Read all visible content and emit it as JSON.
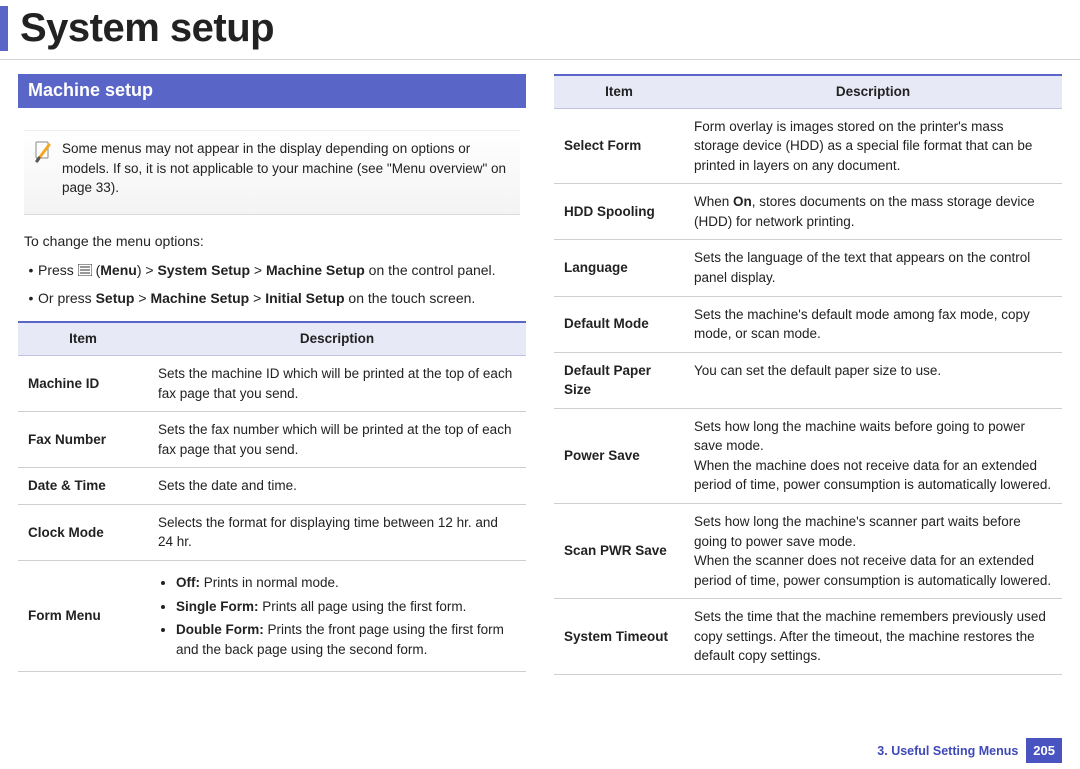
{
  "title": "System setup",
  "section_heading": "Machine setup",
  "note": "Some menus may not appear in the display depending on options or models. If so, it is not applicable to your machine (see \"Menu overview\" on page 33).",
  "intro": "To change the menu options:",
  "steps": {
    "s1_pre": "Press ",
    "s1_b1": "Menu",
    "s1_mid1": ") > ",
    "s1_b2": "System Setup",
    "s1_mid2": " > ",
    "s1_b3": "Machine Setup",
    "s1_post": " on the control panel.",
    "s2_pre": "Or press ",
    "s2_b1": "Setup",
    "s2_mid1": " > ",
    "s2_b2": "Machine Setup",
    "s2_mid2": " > ",
    "s2_b3": "Initial Setup",
    "s2_post": " on the touch screen."
  },
  "th_item": "Item",
  "th_desc": "Description",
  "tableA": {
    "r0": {
      "item": "Machine ID",
      "desc": "Sets the machine ID which will be printed at the top of each fax page that you send."
    },
    "r1": {
      "item": "Fax Number",
      "desc": "Sets the fax number which will be printed at the top of each fax page that you send."
    },
    "r2": {
      "item": "Date & Time",
      "desc": "Sets the date and time."
    },
    "r3": {
      "item": "Clock Mode",
      "desc": "Selects the format for displaying time between 12 hr. and 24 hr."
    },
    "r4": {
      "item": "Form Menu"
    },
    "form_menu": {
      "b0_label": "Off:",
      "b0_rest": " Prints in normal mode.",
      "b1_label": "Single Form:",
      "b1_rest": " Prints all page using the first form.",
      "b2_label": "Double Form:",
      "b2_rest": " Prints the front page using the first form and the back page using the second form."
    }
  },
  "tableB": {
    "r0": {
      "item": "Select Form"
    },
    "select_form": "Form overlay is images stored on the printer's mass storage device (HDD) as a special file format that can be printed in layers on any document.",
    "r1": {
      "item": "HDD Spooling"
    },
    "hdd_pre": "When ",
    "hdd_bold": "On",
    "hdd_post": ", stores documents on the mass storage device (HDD) for network printing.",
    "r2": {
      "item": "Language",
      "desc": "Sets the language of the text that appears on the control panel display."
    },
    "r3": {
      "item": "Default Mode",
      "desc": "Sets the machine's default mode among fax mode, copy mode, or scan mode."
    },
    "r4": {
      "item": "Default Paper Size",
      "desc": "You can set the default paper size to use."
    },
    "r5": {
      "item": "Power Save"
    },
    "power_p1": "Sets how long the machine waits before going to power save mode.",
    "power_p2": "When the machine does not receive data for an extended period of time, power consumption is automatically lowered.",
    "r6": {
      "item": "Scan PWR Save"
    },
    "scan_p1": "Sets how long the machine's scanner part waits before going to power save mode.",
    "scan_p2": "When the scanner does not receive data for an extended period of time, power consumption is automatically lowered.",
    "r7": {
      "item": "System Timeout",
      "desc": "Sets the time that the machine remembers previously used copy settings. After the timeout, the machine restores the default copy settings."
    }
  },
  "footer_chapter": "3.  Useful Setting Menus",
  "footer_page": "205"
}
